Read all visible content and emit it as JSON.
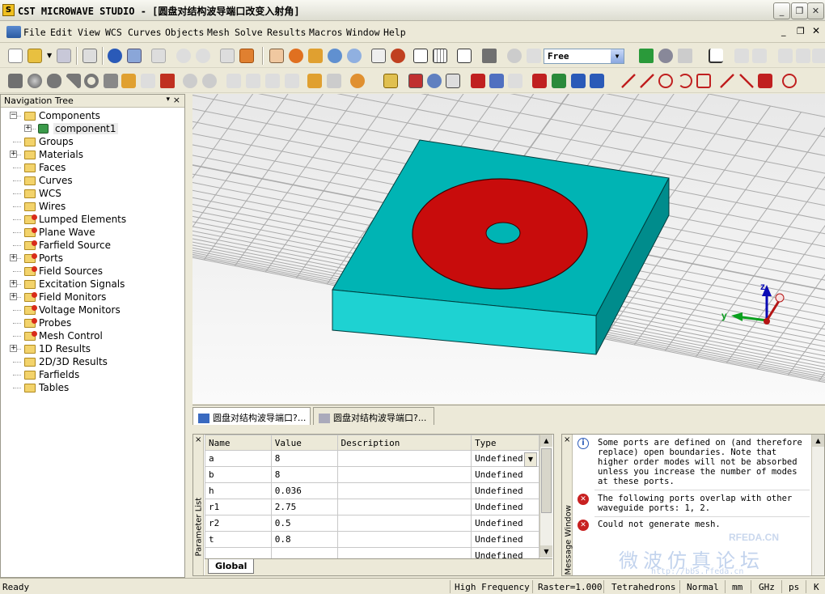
{
  "window": {
    "title": "CST MICROWAVE STUDIO - [圆盘对结构波导端口改变入射角]"
  },
  "menu": [
    "File",
    "Edit",
    "View",
    "WCS",
    "Curves",
    "Objects",
    "Mesh",
    "Solve",
    "Results",
    "Macros",
    "Window",
    "Help"
  ],
  "toolbar": {
    "mode_select_value": "Free"
  },
  "nav_tree": {
    "title": "Navigation Tree",
    "items": [
      {
        "label": "Components",
        "expand": "−",
        "level": 0,
        "icon": "folder"
      },
      {
        "label": "component1",
        "expand": "+",
        "level": 1,
        "icon": "component-icon"
      },
      {
        "label": "Groups",
        "expand": "",
        "level": 0,
        "icon": "folder"
      },
      {
        "label": "Materials",
        "expand": "+",
        "level": 0,
        "icon": "folder"
      },
      {
        "label": "Faces",
        "expand": "",
        "level": 0,
        "icon": "folder"
      },
      {
        "label": "Curves",
        "expand": "",
        "level": 0,
        "icon": "folder"
      },
      {
        "label": "WCS",
        "expand": "",
        "level": 0,
        "icon": "folder"
      },
      {
        "label": "Wires",
        "expand": "",
        "level": 0,
        "icon": "folder"
      },
      {
        "label": "Lumped Elements",
        "expand": "",
        "level": 0,
        "icon": "folder-red"
      },
      {
        "label": "Plane Wave",
        "expand": "",
        "level": 0,
        "icon": "folder-red"
      },
      {
        "label": "Farfield Source",
        "expand": "",
        "level": 0,
        "icon": "folder-red"
      },
      {
        "label": "Ports",
        "expand": "+",
        "level": 0,
        "icon": "folder-red"
      },
      {
        "label": "Field Sources",
        "expand": "",
        "level": 0,
        "icon": "folder-red"
      },
      {
        "label": "Excitation Signals",
        "expand": "+",
        "level": 0,
        "icon": "folder"
      },
      {
        "label": "Field Monitors",
        "expand": "+",
        "level": 0,
        "icon": "folder-red"
      },
      {
        "label": "Voltage Monitors",
        "expand": "",
        "level": 0,
        "icon": "folder-red"
      },
      {
        "label": "Probes",
        "expand": "",
        "level": 0,
        "icon": "folder-red"
      },
      {
        "label": "Mesh Control",
        "expand": "",
        "level": 0,
        "icon": "folder-red"
      },
      {
        "label": "1D Results",
        "expand": "+",
        "level": 0,
        "icon": "folder"
      },
      {
        "label": "2D/3D Results",
        "expand": "",
        "level": 0,
        "icon": "folder"
      },
      {
        "label": "Farfields",
        "expand": "",
        "level": 0,
        "icon": "folder"
      },
      {
        "label": "Tables",
        "expand": "",
        "level": 0,
        "icon": "folder"
      }
    ]
  },
  "viewport": {
    "axes": {
      "x": "x",
      "y": "y",
      "z": "z"
    }
  },
  "doc_tabs": [
    "圆盘对结构波导端口?...",
    "圆盘对结构波导端口?..."
  ],
  "parameter_list": {
    "side_label": "Parameter List",
    "columns": [
      "Name",
      "Value",
      "Description",
      "Type"
    ],
    "rows": [
      {
        "name": "a",
        "value": "8",
        "description": "",
        "type": "Undefined"
      },
      {
        "name": "b",
        "value": "8",
        "description": "",
        "type": "Undefined"
      },
      {
        "name": "h",
        "value": "0.036",
        "description": "",
        "type": "Undefined"
      },
      {
        "name": "r1",
        "value": "2.75",
        "description": "",
        "type": "Undefined"
      },
      {
        "name": "r2",
        "value": "0.5",
        "description": "",
        "type": "Undefined"
      },
      {
        "name": "t",
        "value": "0.8",
        "description": "",
        "type": "Undefined"
      },
      {
        "name": "",
        "value": "",
        "description": "",
        "type": "Undefined"
      }
    ],
    "tab": "Global"
  },
  "message_window": {
    "side_label": "Message Window",
    "messages": [
      {
        "icon": "info-icon",
        "text": "Some ports are defined on (and therefore replace) open boundaries. Note that higher order modes will not be absorbed unless you increase the number of modes at these ports."
      },
      {
        "icon": "error-icon",
        "text": "The following ports overlap with other waveguide ports: 1, 2."
      },
      {
        "icon": "error-icon",
        "text": "Could not generate mesh."
      }
    ]
  },
  "watermark": {
    "brand": "RFEDA.CN",
    "cn": "微波仿真论坛",
    "url": "http://bbs.rfeda.cn"
  },
  "status": {
    "left": "Ready",
    "fields": [
      "High Frequency",
      "Raster=1.000",
      "Tetrahedrons",
      "Normal",
      "mm",
      "GHz",
      "ps",
      "K"
    ]
  },
  "colors": {
    "substrate": "#00b4b4",
    "disk": "#c80c0c",
    "grid_bg": "#f0f0f0"
  }
}
